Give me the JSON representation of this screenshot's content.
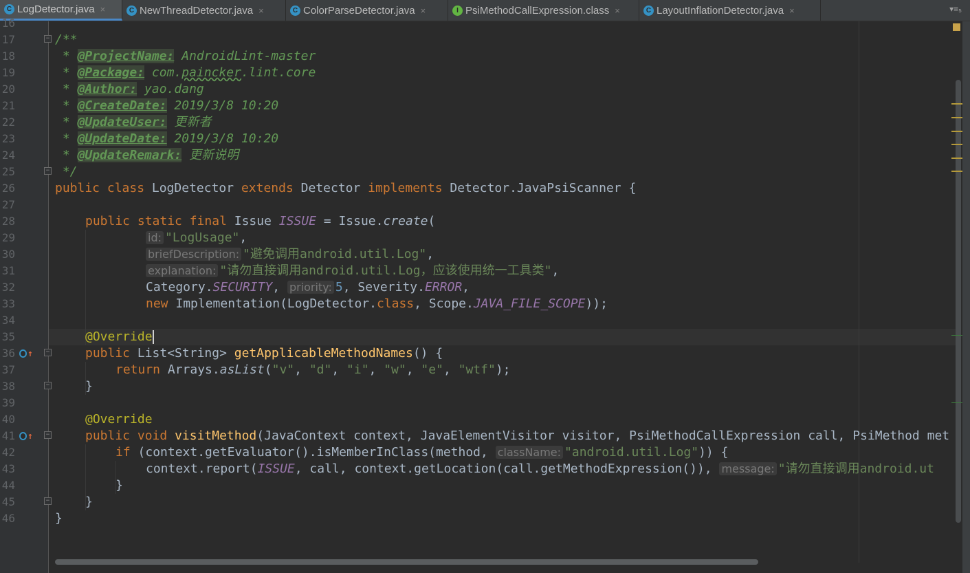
{
  "tabs": [
    {
      "label": "LogDetector.java",
      "icon": "class-icon",
      "active": true
    },
    {
      "label": "NewThreadDetector.java",
      "icon": "class-icon"
    },
    {
      "label": "ColorParseDetector.java",
      "icon": "class-icon"
    },
    {
      "label": "PsiMethodCallExpression.class",
      "icon": "interface-icon"
    },
    {
      "label": "LayoutInflationDetector.java",
      "icon": "class-icon"
    }
  ],
  "tab_close_glyph": "×",
  "tab_menu_glyph": "▾≡₅",
  "line_numbers": [
    "16",
    "17",
    "18",
    "19",
    "20",
    "21",
    "22",
    "23",
    "24",
    "25",
    "26",
    "27",
    "28",
    "29",
    "30",
    "31",
    "32",
    "33",
    "34",
    "35",
    "36",
    "37",
    "38",
    "39",
    "40",
    "41",
    "42",
    "43",
    "44",
    "45",
    "46"
  ],
  "code": {
    "l17": "/**",
    "l18_pre": " * ",
    "l18_tag": "@ProjectName:",
    "l18_val": " AndroidLint-master",
    "l19_pre": " * ",
    "l19_tag": "@Package:",
    "l19_val1": " com.",
    "l19_val2": "paincker",
    "l19_val3": ".lint.core",
    "l20_pre": " * ",
    "l20_tag": "@Author:",
    "l20_val": " yao.dang",
    "l21_pre": " * ",
    "l21_tag": "@CreateDate:",
    "l21_val": " 2019/3/8 10:20",
    "l22_pre": " * ",
    "l22_tag": "@UpdateUser:",
    "l22_val": " 更新者",
    "l23_pre": " * ",
    "l23_tag": "@UpdateDate:",
    "l23_val": " 2019/3/8 10:20",
    "l24_pre": " * ",
    "l24_tag": "@UpdateRemark:",
    "l24_val": " 更新说明",
    "l25": " */",
    "l26_kw1": "public class",
    "l26_a": " LogDetector ",
    "l26_kw2": "extends",
    "l26_b": " Detector ",
    "l26_kw3": "implements",
    "l26_c": " Detector.JavaPsiScanner {",
    "l28_kw": "public static final",
    "l28_a": " Issue ",
    "l28_sf": "ISSUE",
    "l28_b": " = Issue.",
    "l28_it": "create",
    "l28_c": "(",
    "l29_hint": "id:",
    "l29_st": "\"LogUsage\"",
    "l29_c": ",",
    "l30_hint": "briefDescription:",
    "l30_st": "\"避免调用android.util.Log\"",
    "l30_c": ",",
    "l31_hint": "explanation:",
    "l31_st": "\"请勿直接调用android.util.Log，应该使用统一工具类\"",
    "l31_c": ",",
    "l32_a": "Category.",
    "l32_sf": "SECURITY",
    "l32_b": ", ",
    "l32_hint": "priority:",
    "l32_num": "5",
    "l32_c": ", Severity.",
    "l32_sf2": "ERROR",
    "l32_d": ",",
    "l33_kw": "new",
    "l33_a": " Implementation(LogDetector.",
    "l33_kw2": "class",
    "l33_b": ", Scope.",
    "l33_sf": "JAVA_FILE_SCOPE",
    "l33_c": "));",
    "l35_ann": "@Override",
    "l36_kw": "public",
    "l36_a": " List<String> ",
    "l36_fn": "getApplicableMethodNames",
    "l36_b": "() {",
    "l37_kw": "return",
    "l37_a": " Arrays.",
    "l37_it": "asList",
    "l37_b": "(",
    "l37_s1": "\"v\"",
    "l37_s2": "\"d\"",
    "l37_s3": "\"i\"",
    "l37_s4": "\"w\"",
    "l37_s5": "\"e\"",
    "l37_s6": "\"wtf\"",
    "l37_sep": ", ",
    "l37_c": ");",
    "l38": "}",
    "l40_ann": "@Override",
    "l41_kw": "public void",
    "l41_fn": "visitMethod",
    "l41_a": "(JavaContext context, JavaElementVisitor visitor, PsiMethodCallExpression call, PsiMethod met",
    "l42_kw": "if",
    "l42_a": " (context.getEvaluator().isMemberInClass(method, ",
    "l42_hint": "className:",
    "l42_st": "\"android.util.Log\"",
    "l42_b": ")) {",
    "l43_a": "context.report(",
    "l43_sf": "ISSUE",
    "l43_b": ", call, context.getLocation(call.getMethodExpression()), ",
    "l43_hint": "message:",
    "l43_st": "\"请勿直接调用android.ut",
    "l44": "}",
    "l45": "}",
    "l46": "}"
  },
  "colors": {
    "background": "#2b2b2b",
    "keyword": "#cc7832",
    "comment": "#629755",
    "string": "#6a8759",
    "annotation": "#bbb529",
    "method": "#ffc66d",
    "static_field": "#9876aa",
    "number": "#6897bb",
    "text": "#a9b7c6"
  },
  "gutter_icons": [
    "override-method-icon",
    "override-method-icon"
  ]
}
